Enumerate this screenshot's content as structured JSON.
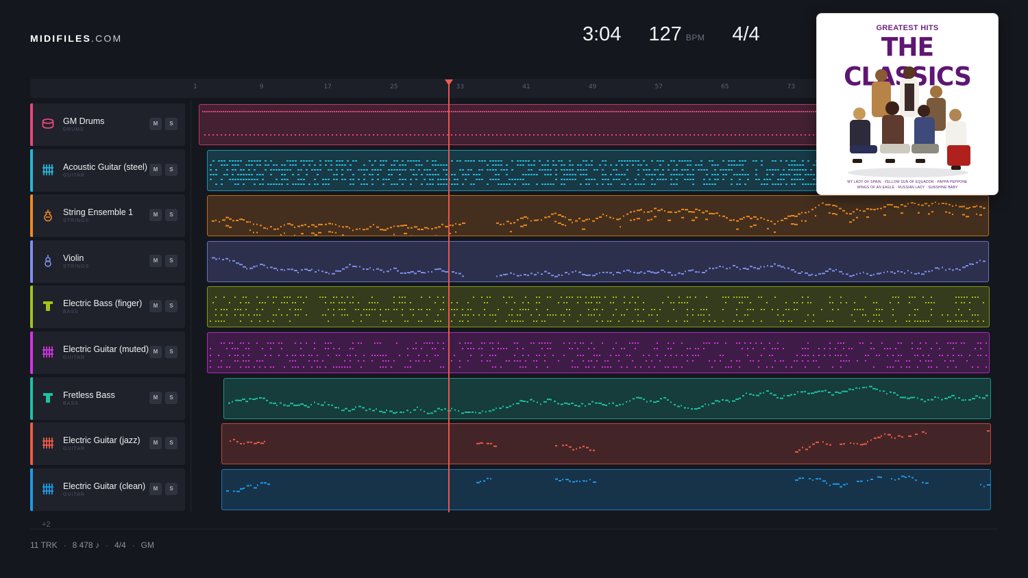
{
  "brand": {
    "bold": "MIDIFILES",
    "light": ".COM"
  },
  "song": {
    "duration": "3:04",
    "tempo": "127",
    "tempo_unit": "BPM",
    "time_signature": "4/4"
  },
  "ruler": {
    "labels": [
      "1",
      "9",
      "17",
      "25",
      "33",
      "41",
      "49",
      "57",
      "65",
      "73"
    ]
  },
  "tracks": [
    {
      "name": "GM Drums",
      "category": "DRUMS",
      "color": "#e8477c",
      "icon": "drum-icon"
    },
    {
      "name": "Acoustic Guitar (steel)",
      "category": "GUITAR",
      "color": "#26b6d6",
      "icon": "guitar-grid-icon"
    },
    {
      "name": "String Ensemble 1",
      "category": "STRINGS",
      "color": "#ef8a1e",
      "icon": "strings-icon"
    },
    {
      "name": "Violin",
      "category": "STRINGS",
      "color": "#7f8ff0",
      "icon": "violin-icon"
    },
    {
      "name": "Electric Bass (finger)",
      "category": "BASS",
      "color": "#a5c21a",
      "icon": "bass-icon"
    },
    {
      "name": "Electric Guitar (muted)",
      "category": "GUITAR",
      "color": "#d633e0",
      "icon": "guitar-grid-icon"
    },
    {
      "name": "Fretless Bass",
      "category": "BASS",
      "color": "#1cc2a4",
      "icon": "bass-icon"
    },
    {
      "name": "Electric Guitar (jazz)",
      "category": "GUITAR",
      "color": "#ef5a48",
      "icon": "guitar-grid-icon"
    },
    {
      "name": "Electric Guitar (clean)",
      "category": "GUITAR",
      "color": "#1e9be6",
      "icon": "guitar-grid-icon"
    }
  ],
  "buttons": {
    "mute": "M",
    "solo": "S"
  },
  "overflow": "+2",
  "footer": {
    "tracks": "11 TRK",
    "notes": "8 478 ♪",
    "meter": "4/4",
    "standard": "GM"
  },
  "album": {
    "subtitle": "GREATEST HITS",
    "title": "THE CLASSICS",
    "tracklist_1": "MY LADY OF SPAIN · YELLOW SUN OF EQUADOR · PAPPA PEPPONE",
    "tracklist_2": "WINGS OF AN EAGLE · RUSSIAN LADY · SUNSHINE BABY"
  }
}
